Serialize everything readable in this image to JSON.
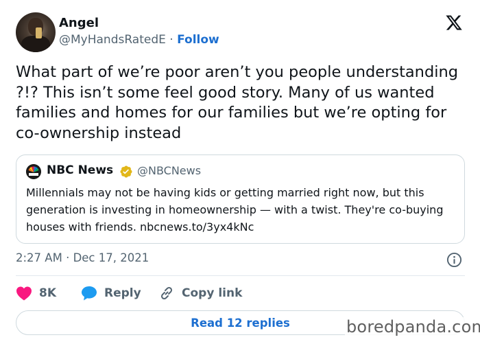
{
  "author": {
    "name": "Angel",
    "handle": "@MyHandsRatedE",
    "separator": "·",
    "follow_label": "Follow"
  },
  "tweet": {
    "text": "What part of we’re poor aren’t you people understanding ?!? This isn’t some feel good story. Many of us wanted families and homes for our families but we’re opting for co-ownership instead"
  },
  "quote": {
    "name": "NBC News",
    "handle": "@NBCNews",
    "text": "Millennials may not be having kids or getting married right now, but this generation is investing in homeownership — with a twist. They're co-buying houses with friends. nbcnews.to/3yx4kNc"
  },
  "meta": {
    "time": "2:27 AM",
    "separator": "·",
    "date": "Dec 17, 2021"
  },
  "actions": {
    "likes": "8K",
    "reply_label": "Reply",
    "copy_link_label": "Copy link"
  },
  "replies_button": {
    "label": "Read 12 replies"
  },
  "watermark": {
    "text": "boredpanda.com"
  },
  "colors": {
    "link_blue": "#1d6fd0",
    "heart_red": "#f91880",
    "secondary_text": "#536471",
    "verified_gold": "#e2b719"
  },
  "icons": {
    "platform_logo": "x-logo-icon",
    "like": "heart-icon",
    "reply": "speech-bubble-icon",
    "copy": "link-icon",
    "info": "info-icon",
    "verified": "verified-badge-icon"
  }
}
